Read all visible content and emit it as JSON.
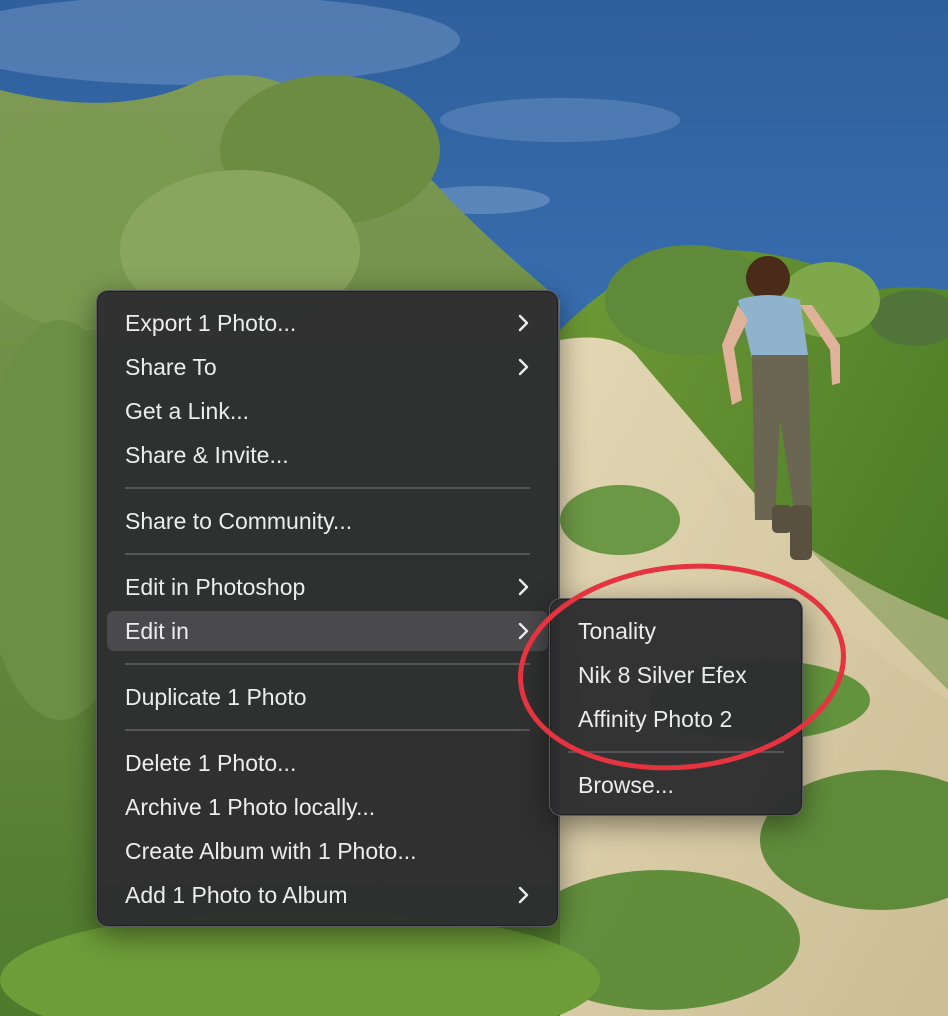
{
  "context_menu": {
    "items": [
      {
        "label": "Export 1 Photo...",
        "submenu": true
      },
      {
        "label": "Share To",
        "submenu": true
      },
      {
        "label": "Get a Link...",
        "submenu": false
      },
      {
        "label": "Share & Invite...",
        "submenu": false
      },
      {
        "label": "Share to Community...",
        "submenu": false
      },
      {
        "label": "Edit in Photoshop",
        "submenu": true
      },
      {
        "label": "Edit in",
        "submenu": true,
        "active": true
      },
      {
        "label": "Duplicate 1 Photo",
        "submenu": false
      },
      {
        "label": "Delete 1 Photo...",
        "submenu": false
      },
      {
        "label": "Archive 1 Photo locally...",
        "submenu": false
      },
      {
        "label": "Create Album with 1 Photo...",
        "submenu": false
      },
      {
        "label": "Add 1 Photo to Album",
        "submenu": true
      }
    ]
  },
  "edit_in_submenu": {
    "items": [
      {
        "label": "Tonality"
      },
      {
        "label": "Nik 8 Silver Efex"
      },
      {
        "label": "Affinity Photo 2"
      },
      {
        "label": "Browse..."
      }
    ]
  },
  "icons": {
    "submenu_arrow": "chevron-right-icon"
  },
  "colors": {
    "menu_background": "#2d2d2f",
    "menu_text": "#ececec",
    "highlight": "#4a4a4d",
    "callout_ring": "#e5333f"
  }
}
